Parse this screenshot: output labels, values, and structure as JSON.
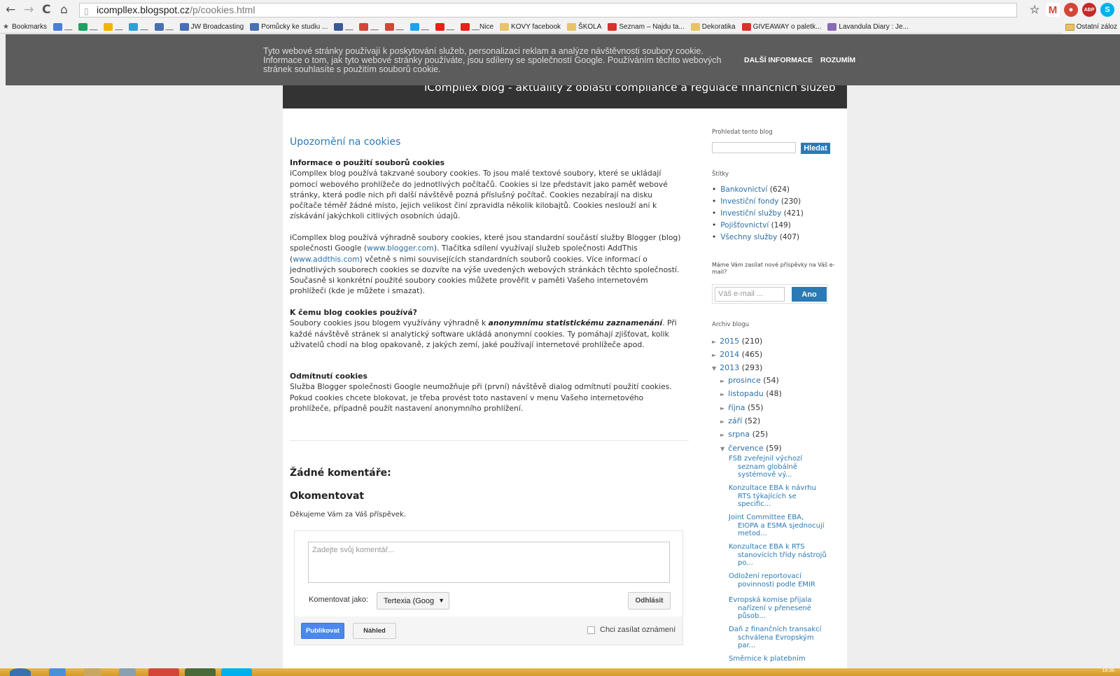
{
  "browser": {
    "url_host": "icompllex.blogspot.cz",
    "url_path": "/p/cookies.html",
    "bookmarks_label": "Bookmarks",
    "bookmarks": [
      {
        "label": "__",
        "color": "#4a7fd8"
      },
      {
        "label": "__",
        "color": "#1aa260"
      },
      {
        "label": "__",
        "color": "#f4b400"
      },
      {
        "label": "__",
        "color": "#2d9fd9"
      },
      {
        "label": "__",
        "color": "#4a6fb5"
      },
      {
        "label": "JW Broadcasting",
        "color": "#4a6fb5"
      },
      {
        "label": "Pomůcky ke studiu ...",
        "color": "#4a6fb5"
      },
      {
        "label": "__",
        "color": "#3b5998"
      },
      {
        "label": "__",
        "color": "#d44638"
      },
      {
        "label": "__",
        "color": "#d44638"
      },
      {
        "label": "__",
        "color": "#1da1f2"
      },
      {
        "label": "__",
        "color": "#e62117"
      },
      {
        "label": "__Nice",
        "color": "#e62117"
      },
      {
        "label": "KOVY facebook",
        "color": "#e8c468"
      },
      {
        "label": "ŠKOLA",
        "color": "#e8c468"
      },
      {
        "label": "Seznam – Najdu ta...",
        "color": "#d8322a"
      },
      {
        "label": "Dekoratika",
        "color": "#e8c468"
      },
      {
        "label": "GIVEAWAY o paletk...",
        "color": "#d8322a"
      },
      {
        "label": "Lavandula Diary : Je...",
        "color": "#8a6bb5"
      }
    ],
    "other_bookmarks": "Ostatní záloz"
  },
  "cookie_bar": {
    "text": "Tyto webové stránky používají k poskytování služeb, personalizaci reklam a analýze návštěvnosti soubory cookie. Informace o tom, jak tyto webové stránky používáte, jsou sdíleny se společností Google. Používáním těchto webových stránek souhlasíte s použitím souborů cookie.",
    "more_info": "DALŠÍ INFORMACE",
    "accept": "ROZUMÍM"
  },
  "blog": {
    "header": "iCompllex blog - aktuality z oblasti compliance a regulace finančních služeb"
  },
  "post": {
    "title": "Upozornění na cookies",
    "s1_heading": "Informace o použití souborů cookies",
    "s1_body": "iCompllex blog používá takzvané soubory cookies. To jsou malé textové soubory, které se ukládají pomocí webového prohlížeče do jednotlivých počítačů. Cookies si lze představit jako paměť webové stránky, která podle nich při další návštěvě pozná příslušný počítač. Cookies nezabírají na disku počítače téměř žádné místo, jejich velikost činí zpravidla několik kilobajtů. Cookies neslouží ani k získávání jakýchkoli citlivých osobních údajů.",
    "s2_a": "iCompllex blog používá výhradně soubory cookies, které jsou standardní součástí služby Blogger (blog) společnosti Google (",
    "s2_link1": "www.blogger.com",
    "s2_b": "). Tlačítka sdílení využívají služeb společnosti AddThis (",
    "s2_link2": "www.addthis.com",
    "s2_c": ") včetně s nimi souvisejících standardních souborů cookies. Více informací o jednotlivých souborech cookies se dozvíte na výše uvedených webových stránkách těchto společností. Současně si konkrétní použité soubory cookies můžete prověřit v paměti Vašeho internetovém prohlížeči (kde je můžete i smazat).",
    "s3_heading": "K čemu blog cookies používá?",
    "s3_a": "Soubory cookies jsou blogem využívány výhradně k ",
    "s3_em": "anonymnímu statistickému zaznamenání",
    "s3_b": ". Při každé návštěvě stránek si analytický software ukládá anonymní cookies. Ty pomáhají zjišťovat, kolik uživatelů chodí na blog opakovaně, z jakých zemí, jaké používají internetové prohlížeče apod.",
    "s4_heading": "Odmítnutí cookies",
    "s4_body": "Služba Blogger společnosti Google neumožňuje při (první) návštěvě dialog odmítnutí použití cookies. Pokud cookies chcete blokovat, je třeba provést toto nastavení v menu Vašeho internetového prohlížeče, případně použít nastavení anonymního prohlížení."
  },
  "comments": {
    "none": "Žádné komentáře:",
    "heading": "Okomentovat",
    "thanks": "Děkujeme Vám za Váš příspěvek.",
    "placeholder": "Zadejte svůj komentář...",
    "as_label": "Komentovat jako:",
    "as_value": "Tertexia (Goog",
    "logout": "Odhlásit",
    "publish": "Publikovat",
    "preview": "Náhled",
    "notify": "Chci zasílat oznámení"
  },
  "sidebar": {
    "search_heading": "Prohledat tento blog",
    "search_button": "Hledat",
    "labels_heading": "Štítky",
    "labels": [
      {
        "name": "Bankovnictví",
        "count": "(624)"
      },
      {
        "name": "Investiční fondy",
        "count": "(230)"
      },
      {
        "name": "Investiční služby",
        "count": "(421)"
      },
      {
        "name": "Pojišťovnictví",
        "count": "(149)"
      },
      {
        "name": "Všechny služby",
        "count": "(407)"
      }
    ],
    "subscribe_heading": "Máme Vám zasílat nové příspěvky na Váš e-mail?",
    "email_placeholder": "Váš e-mail ...",
    "email_button": "Ano",
    "archive_heading": "Archiv blogu",
    "years": [
      {
        "year": "2015",
        "count": "(210)",
        "tri": "►"
      },
      {
        "year": "2014",
        "count": "(465)",
        "tri": "►"
      },
      {
        "year": "2013",
        "count": "(293)",
        "tri": "▼"
      }
    ],
    "months": [
      {
        "name": "prosince",
        "count": "(54)",
        "tri": "►"
      },
      {
        "name": "listopadu",
        "count": "(48)",
        "tri": "►"
      },
      {
        "name": "října",
        "count": "(55)",
        "tri": "►"
      },
      {
        "name": "září",
        "count": "(52)",
        "tri": "►"
      },
      {
        "name": "srpna",
        "count": "(25)",
        "tri": "►"
      },
      {
        "name": "července",
        "count": "(59)",
        "tri": "▼"
      }
    ],
    "posts": [
      {
        "l1": "FSB zveřejnil výchozí",
        "l2": "seznam globálně",
        "l3": "systémově vý..."
      },
      {
        "l1": "Konzultace EBA k návrhu",
        "l2": "RTS týkajících se",
        "l3": "specific..."
      },
      {
        "l1": "Joint Committee EBA,",
        "l2": "EIOPA a ESMA sjednocují",
        "l3": "metod..."
      },
      {
        "l1": "Konzultace EBA k RTS",
        "l2": "stanovících třídy nástrojů",
        "l3": "po..."
      },
      {
        "l1": "Odložení reportovací",
        "l2": "povinnosti podle EMIR",
        "l3": ""
      },
      {
        "l1": "Evropská komise přijala",
        "l2": "nařízení v přenesené",
        "l3": "působ..."
      },
      {
        "l1": "Daň z finančních transakcí",
        "l2": "schválena Evropským",
        "l3": "par..."
      },
      {
        "l1": "Směrnice k platebním",
        "l2": "",
        "l3": ""
      }
    ]
  },
  "taskbar": {
    "clock": "18:36"
  }
}
